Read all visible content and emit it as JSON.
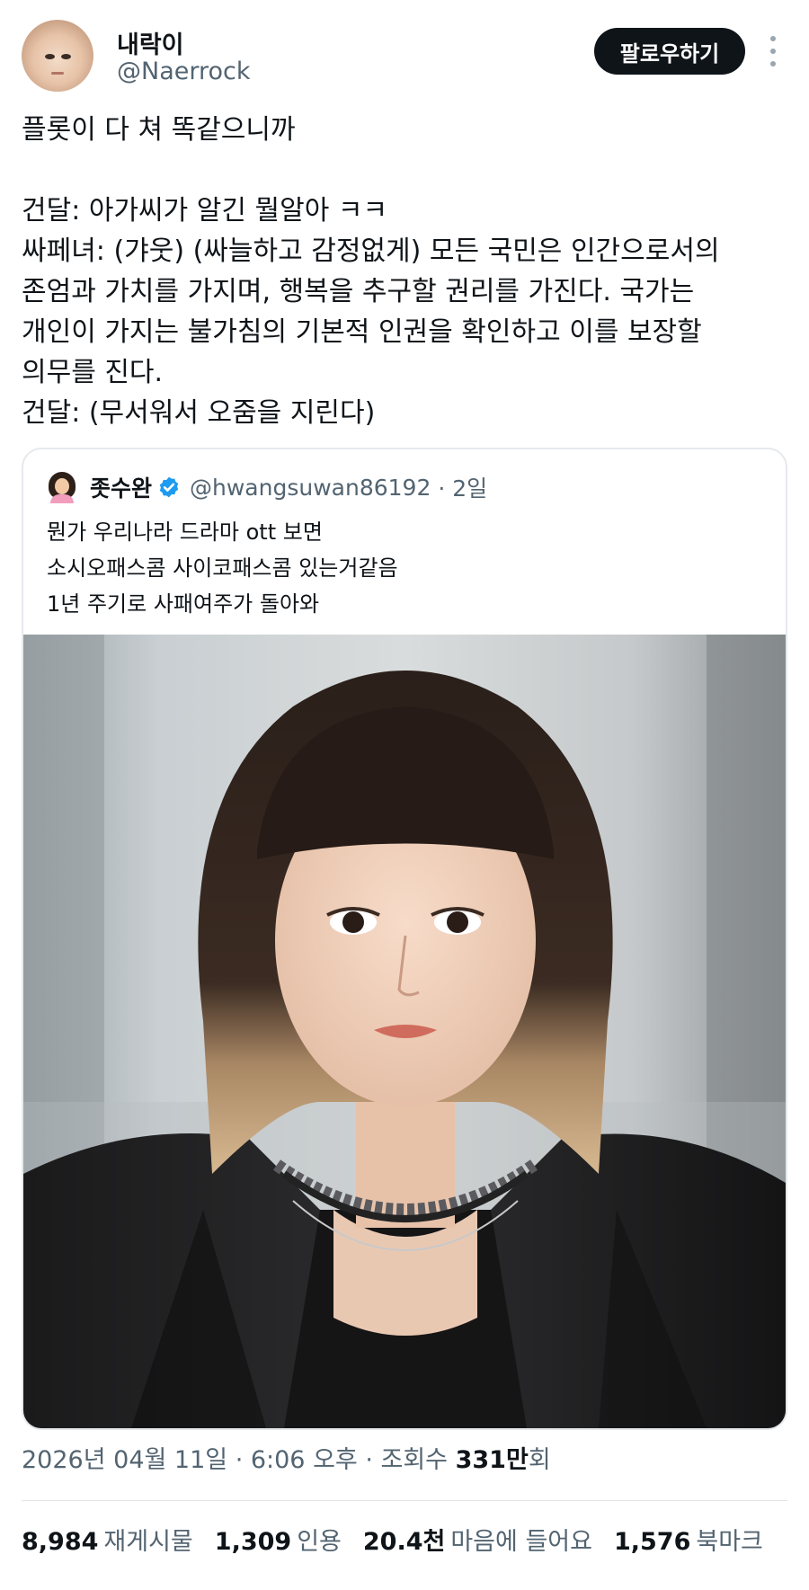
{
  "author": {
    "display_name": "내락이",
    "handle": "@Naerrock",
    "follow_label": "팔로우하기"
  },
  "tweet": {
    "lines": [
      "플롯이 다 쳐 똑같으니까",
      "",
      "건달: 아가씨가 알긴 뭘알아 ㅋㅋ",
      "싸페녀: (갸웃) (싸늘하고 감정없게) 모든 국민은 인간으로서의",
      "존엄과 가치를 가지며, 행복을 추구할 권리를 가진다. 국가는",
      "개인이 가지는 불가침의 기본적 인권을 확인하고 이를 보장할",
      "의무를 진다.",
      "건달: (무서워서 오줌을 지린다)"
    ]
  },
  "quote": {
    "display_name": "좃수완",
    "handle": "@hwangsuwan86192",
    "time": "· 2일",
    "lines": [
      "뭔가 우리나라 드라마 ott 보면",
      "소시오패스콤 사이코패스콤 있는거같음",
      "1년 주기로 사패여주가 돌아와"
    ]
  },
  "meta": {
    "timestamp": "2026년 04월 11일 · 6:06 오후 · 조회수 ",
    "views_number": "331만",
    "views_suffix": "회"
  },
  "stats": [
    {
      "number": "8,984",
      "label": "재게시물"
    },
    {
      "number": "1,309",
      "label": "인용"
    },
    {
      "number": "20.4천",
      "label": "마음에 들어요"
    },
    {
      "number": "1,576",
      "label": "북마크"
    }
  ],
  "colors": {
    "text_primary": "#0f1419",
    "text_secondary": "#536471",
    "verified_blue": "#1d9bf0",
    "follow_button_bg": "#0f1419",
    "border": "#e6e9ec"
  },
  "icons": [
    "more-options-icon",
    "verified-badge-icon"
  ]
}
